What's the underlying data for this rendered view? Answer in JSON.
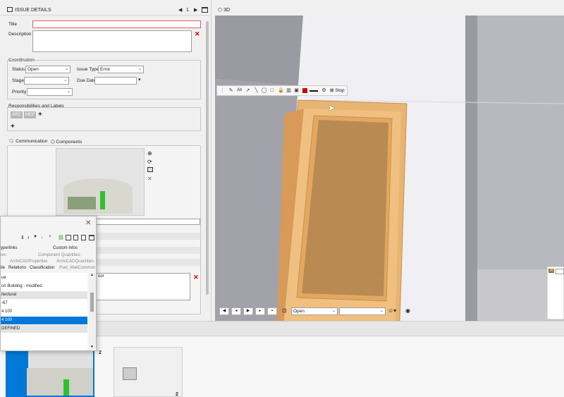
{
  "issue_panel": {
    "title": "ISSUE DETAILS",
    "page": "1",
    "fields": {
      "title_label": "Title",
      "description_label": "Description",
      "coordination_label": "Coordination",
      "status_label": "Status",
      "status_value": "Open",
      "issue_type_label": "Issue Type",
      "issue_type_value": "Error",
      "stage_label": "Stage",
      "due_date_label": "Due Date",
      "priority_label": "Priority"
    },
    "responsibilities_label": "Responsibilities and Labels",
    "tags": [
      "ARC",
      "MEP"
    ],
    "tabs": [
      "Communication",
      "Components"
    ],
    "comment_text": "oor"
  },
  "viewport": {
    "tab_label": "3D",
    "toolbar": {
      "stop_label": "Stop",
      "text_tool": "Ab"
    },
    "bottom": {
      "status_value": "Open"
    },
    "corner_badge": "JR"
  },
  "properties_window": {
    "tabs_row1": [
      "yperlinks",
      "Custom infos"
    ],
    "tabs_row2": [
      "ies",
      "Component Quantities"
    ],
    "tabs_row3": [
      "ArchiCADProperties",
      "ArchiCADQuantities"
    ],
    "tabs_row4": [
      "ile",
      "Relations",
      "Classification",
      "Pset_WallCommon"
    ],
    "rows": [
      "ue",
      "on Building - modified",
      "itectural",
      "-67",
      "4 100",
      "4 100",
      "DEFINED"
    ]
  },
  "thumbnails": {
    "count_1": "2",
    "count_2": "2"
  },
  "colors": {
    "accent": "#0078d7",
    "door": "#e8b472",
    "red": "#cc0000"
  }
}
